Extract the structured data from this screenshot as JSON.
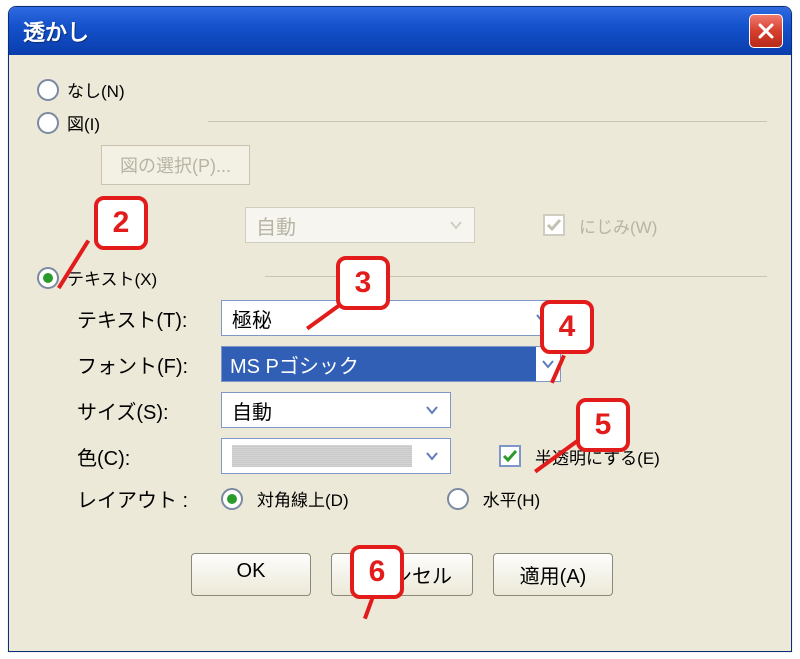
{
  "window": {
    "title": "透かし"
  },
  "radios": {
    "none": "なし(N)",
    "image": "図(I)",
    "text": "テキスト(X)"
  },
  "image_section": {
    "select_button": "図の選択(P)...",
    "scale_value": "自動",
    "washout_label": "にじみ(W)"
  },
  "text_section": {
    "text_label": "テキスト(T):",
    "text_value": "極秘",
    "font_label": "フォント(F):",
    "font_value": "MS Pゴシック",
    "size_label": "サイズ(S):",
    "size_value": "自動",
    "color_label": "色(C):",
    "semitrans_label": "半透明にする(E)",
    "layout_label": "レイアウト :",
    "diag_label": "対角線上(D)",
    "horiz_label": "水平(H)"
  },
  "buttons": {
    "ok": "OK",
    "cancel": "キャンセル",
    "apply": "適用(A)"
  },
  "callouts": {
    "c2": "2",
    "c3": "3",
    "c4": "4",
    "c5": "5",
    "c6": "6"
  }
}
